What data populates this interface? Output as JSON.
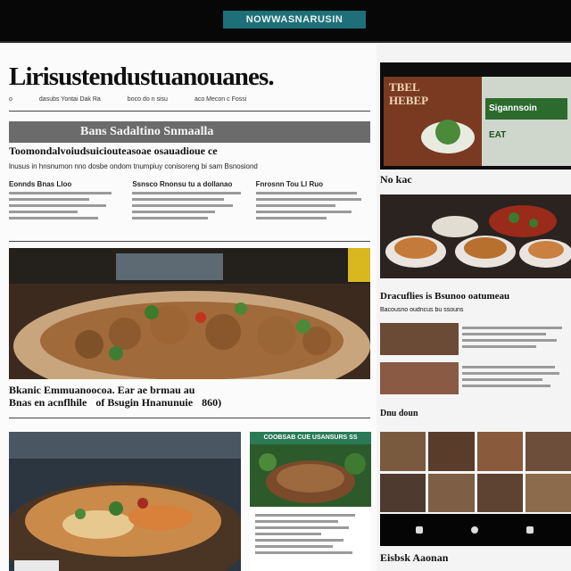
{
  "topbar": {
    "site_label": "NOWWASNARUSIN"
  },
  "main": {
    "masthead": "Lirisustendustuanouanes.",
    "masthead_sub": [
      "o",
      "dasubs Yontai Dak Ra",
      "boco do n sisu",
      "aco Mecon c Fossi"
    ],
    "section_banner": "Bans Sadaltino Snmaalla",
    "dek": "Toomondalvoiudsuiciouteasoae osauadioue ce",
    "deck_line": "lnusus in hnsnumon nno dosbe ondom tnumpiuy conisoreng bi sam Bsnosiond",
    "briefs": [
      {
        "heading": "Eonnds Bnas Lloo",
        "lines": 6
      },
      {
        "heading": "Ssnsco Rnonsu tu a dollanao",
        "lines": 6
      },
      {
        "heading": "Fnrosnn Tou Ll Ruo",
        "lines": 6
      }
    ],
    "caption_a": "Bkanic Emmuanoocoa. Ear ae brmau au",
    "caption_b": [
      "Bnas en acnflhile",
      "of Bsugin Hnanunuie",
      "860)"
    ]
  },
  "bottom": {
    "mid_header": "COOBSAB CUE USANSURS SS"
  },
  "right": {
    "ad_text": "TBEL HEBEP",
    "ad_sign": "Sigannsoin",
    "ad_sub": "EAT",
    "section1": "No kac",
    "section2": "Dracuflies is Bsunoo oatumeau",
    "section2_sub": "Bacousno oudncus bu ssouns",
    "section3": "Dnu doun",
    "footer_title": "Eisbsk Aaonan"
  }
}
